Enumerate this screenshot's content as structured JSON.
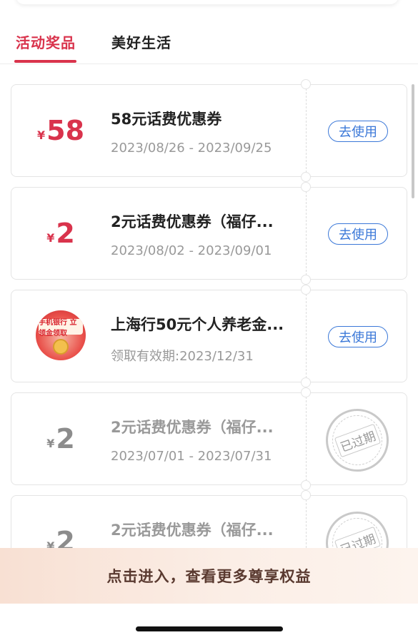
{
  "tabs": [
    {
      "label": "活动奖品",
      "active": true
    },
    {
      "label": "美好生活",
      "active": false
    }
  ],
  "coupons": [
    {
      "currency": "¥",
      "amount": "58",
      "title": "58元话费优惠券",
      "subtitle": "2023/08/26 - 2023/09/25",
      "action": "去使用",
      "status": "active"
    },
    {
      "currency": "¥",
      "amount": "2",
      "title": "2元话费优惠券（福仔...",
      "subtitle": "2023/08/02 - 2023/09/01",
      "action": "去使用",
      "status": "active"
    },
    {
      "thumb_text": "手机银行 立领金领取",
      "title": "上海行50元个人养老金...",
      "subtitle": "领取有效期:2023/12/31",
      "action": "去使用",
      "status": "active"
    },
    {
      "currency": "¥",
      "amount": "2",
      "title": "2元话费优惠券（福仔...",
      "subtitle": "2023/07/01 - 2023/07/31",
      "stamp": "已过期",
      "status": "expired"
    },
    {
      "currency": "¥",
      "amount": "2",
      "title": "2元话费优惠券（福仔...",
      "subtitle": "",
      "stamp": "已过期",
      "status": "expired"
    }
  ],
  "banner": {
    "label": "点击进入，查看更多尊享权益"
  },
  "colors": {
    "accent": "#d9334c",
    "link": "#3b78d8",
    "muted": "#999999"
  }
}
